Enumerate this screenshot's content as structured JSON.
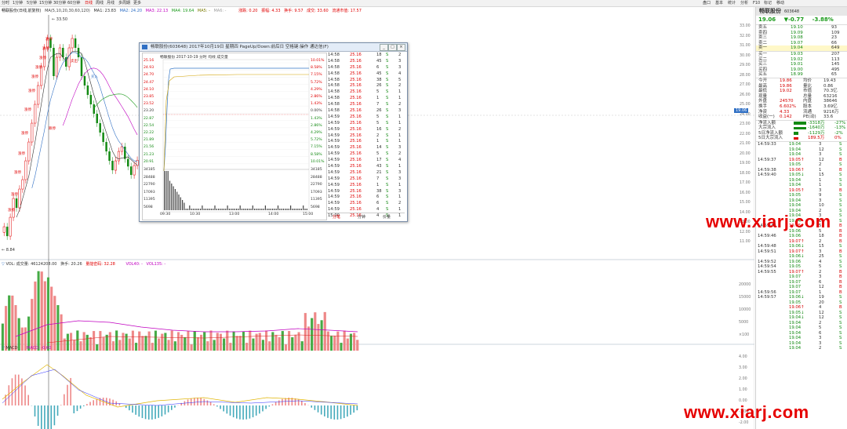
{
  "toolbar": {
    "tabs": [
      "分时",
      "1分钟",
      "5分钟",
      "15分钟",
      "30分钟",
      "60分钟",
      "日线",
      "周线",
      "月线",
      "多周期",
      "更多"
    ],
    "right_tabs": [
      "盘口",
      "基本",
      "统计",
      "分析",
      "F10",
      "标记",
      "移动"
    ]
  },
  "main": {
    "title": "畅联股份(日线,前复权)",
    "ma_label": "MA(5,10,20,30,60,120)",
    "ma_values": [
      "MA1: 23.83",
      "MA2: 24.20",
      "MA3: 22.13",
      "MA4: 19.64",
      "MA5: -",
      "MA6: -"
    ],
    "header_stats": [
      "涨跌: 0.20",
      "振幅: 4.33",
      "换手: 9.57",
      "成交: 33.60",
      "流通市值: 17.57"
    ],
    "high_mark": "33.50",
    "low_mark": "8.84",
    "price_axis": [
      "33.00",
      "32.00",
      "31.00",
      "30.00",
      "29.00",
      "28.00",
      "27.00",
      "26.00",
      "25.00",
      "24.00",
      "23.00",
      "22.00",
      "21.00",
      "20.00",
      "19.00",
      "18.00",
      "17.00",
      "16.00",
      "15.00",
      "14.00",
      "13.00",
      "12.00",
      "11.00"
    ],
    "current_price_tag": "19.06",
    "volume_header": [
      "VOL:",
      "成交量: 46124208.00",
      "换手: 20.26",
      "量能密码: 32.28"
    ],
    "volume_ma": [
      "VOL40: -",
      "VOL135: -"
    ],
    "volume_axis": [
      "20000",
      "15000",
      "10000",
      "5000",
      "×100"
    ],
    "macd_header": [
      "MACD",
      "MACD: -0.60"
    ],
    "macd_axis": [
      "4.00",
      "3.00",
      "2.00",
      "1.00",
      "0.00",
      "-1.00",
      "-2.00"
    ],
    "candles": [
      12,
      11,
      13,
      15,
      14,
      16,
      17,
      19,
      21,
      23,
      25,
      27,
      29,
      31,
      32,
      31,
      28,
      30,
      31,
      30,
      29,
      31,
      32,
      31,
      30,
      28,
      27,
      26,
      25,
      24,
      23,
      22,
      21,
      20,
      19,
      18,
      19,
      20,
      20.5,
      19.2,
      18.4,
      17.5,
      18.5,
      19.06
    ],
    "signal_markers": [
      "涨停",
      "涨停",
      "涨停",
      "涨停",
      "涨停",
      "涨停",
      "涨停",
      "涨停",
      "涨停",
      "涨停",
      "涨停",
      "涨停",
      "跌停",
      "卖出",
      "买入"
    ]
  },
  "popup": {
    "title": "畅联股份(603648)  2017年10月19日 星期四 PageUp/Down:前后日 空格键:操作 通达信(F)",
    "subtitle": "畅联股份  2017-10-19 分时  均线  成交量",
    "price_scale_left": [
      "25.16",
      "24.93",
      "24.70",
      "24.47",
      "24.10",
      "23.85",
      "23.52",
      "23.20",
      "22.87",
      "22.54",
      "22.22",
      "21.89",
      "21.56",
      "21.23",
      "20.91"
    ],
    "price_scale_right": [
      "10.01%",
      "8.58%",
      "7.15%",
      "5.72%",
      "4.29%",
      "2.86%",
      "1.43%",
      "0.00%",
      "1.43%",
      "2.86%",
      "4.29%",
      "5.72%",
      "7.15%",
      "8.58%",
      "10.01%"
    ],
    "vol_scale": [
      "34185",
      "28488",
      "22790",
      "17093",
      "11395",
      "5698"
    ],
    "time_axis": [
      "09:30",
      "10:30",
      "13:00",
      "14:00",
      "15:00"
    ],
    "trades": [
      [
        "14:58",
        "25.16",
        "18",
        "S",
        "2"
      ],
      [
        "14:58",
        "25.16",
        "45",
        "S",
        "3"
      ],
      [
        "14:58",
        "25.16",
        "6",
        "S",
        "3"
      ],
      [
        "14:58",
        "25.16",
        "45",
        "S",
        "4"
      ],
      [
        "14:58",
        "25.16",
        "38",
        "S",
        "5"
      ],
      [
        "14:58",
        "25.16",
        "26",
        "S",
        "2"
      ],
      [
        "14:58",
        "25.16",
        "5",
        "S",
        "1"
      ],
      [
        "14:58",
        "25.16",
        "1",
        "S",
        "1"
      ],
      [
        "14:58",
        "25.16",
        "7",
        "S",
        "2"
      ],
      [
        "14:58",
        "25.16",
        "26",
        "S",
        "3"
      ],
      [
        "14:59",
        "25.16",
        "5",
        "S",
        "1"
      ],
      [
        "14:59",
        "25.16",
        "5",
        "S",
        "1"
      ],
      [
        "14:59",
        "25.16",
        "16",
        "S",
        "2"
      ],
      [
        "14:59",
        "25.16",
        "2",
        "S",
        "1"
      ],
      [
        "14:59",
        "25.16",
        "1",
        "S",
        "1"
      ],
      [
        "14:59",
        "25.16",
        "14",
        "S",
        "3"
      ],
      [
        "14:59",
        "25.16",
        "5",
        "S",
        "2"
      ],
      [
        "14:59",
        "25.16",
        "17",
        "S",
        "4"
      ],
      [
        "14:59",
        "25.16",
        "43",
        "S",
        "1"
      ],
      [
        "14:59",
        "25.16",
        "21",
        "S",
        "3"
      ],
      [
        "14:59",
        "25.16",
        "7",
        "S",
        "3"
      ],
      [
        "14:59",
        "25.16",
        "1",
        "S",
        "1"
      ],
      [
        "14:59",
        "25.16",
        "38",
        "S",
        "3"
      ],
      [
        "14:59",
        "25.16",
        "6",
        "S",
        "1"
      ],
      [
        "14:59",
        "25.16",
        "6",
        "S",
        "2"
      ],
      [
        "14:59",
        "25.16",
        "4",
        "S",
        "1"
      ],
      [
        "15:00",
        "25.16",
        "4",
        "S",
        "1"
      ]
    ],
    "footer_tabs": [
      "分笔",
      "分钟",
      "价量"
    ]
  },
  "right": {
    "name": "畅联股份",
    "code": "603648",
    "price": "19.06",
    "change": "▼-0.77",
    "pct": "-3.88%",
    "asks": [
      [
        "卖五",
        "19.10",
        "93"
      ],
      [
        "卖四",
        "19.09",
        "109"
      ],
      [
        "卖三",
        "19.08",
        "23"
      ],
      [
        "卖二",
        "19.07",
        "66"
      ],
      [
        "卖一",
        "19.04",
        "649"
      ]
    ],
    "bids": [
      [
        "买一",
        "19.03",
        "207"
      ],
      [
        "买二",
        "19.02",
        "113"
      ],
      [
        "买三",
        "19.01",
        "145"
      ],
      [
        "买四",
        "19.00",
        "495"
      ],
      [
        "买五",
        "18.99",
        "65"
      ]
    ],
    "stats": [
      [
        "今开",
        "19.86",
        "均价",
        "19.43"
      ],
      [
        "最高",
        "19.86",
        "量比",
        "0.86"
      ],
      [
        "最低",
        "19.02",
        "市值",
        "70.3亿"
      ],
      [
        "现量",
        "",
        "总量",
        "63216"
      ],
      [
        "外盘",
        "24570",
        "内盘",
        "38646"
      ],
      [
        "换手",
        "6.602%",
        "股本",
        "3.69亿"
      ],
      [
        "净资",
        "4.33",
        "流通",
        "9216万"
      ],
      [
        "收益(一)",
        "0.142",
        "PE(动)",
        "33.6"
      ]
    ],
    "flows": [
      [
        "净流入额",
        "-3318万",
        "-27%"
      ],
      [
        "大宗流入",
        "-1640万",
        "-13%"
      ],
      [
        "5日净流入额",
        "-1129万",
        "-2%"
      ],
      [
        "5日大宗流入",
        "189.5万",
        "0%"
      ]
    ],
    "ticks": [
      [
        "14:59:33",
        "19.04",
        "3",
        "S"
      ],
      [
        "",
        "19.04",
        "12",
        "S"
      ],
      [
        "",
        "19.04",
        "3",
        "S"
      ],
      [
        "14:59:37",
        "19.05↑",
        "12",
        "B"
      ],
      [
        "",
        "19.05",
        "2",
        "S"
      ],
      [
        "14:59:38",
        "19.06↑",
        "1",
        "B"
      ],
      [
        "14:59:40",
        "19.05↓",
        "15",
        "S"
      ],
      [
        "",
        "19.04",
        "1",
        "S"
      ],
      [
        "",
        "19.04",
        "1",
        "S"
      ],
      [
        "",
        "19.05↑",
        "3",
        "B"
      ],
      [
        "",
        "19.05",
        "9",
        "S"
      ],
      [
        "",
        "19.04",
        "3",
        "S"
      ],
      [
        "",
        "19.04",
        "10",
        "S"
      ],
      [
        "",
        "19.04",
        "2",
        "S"
      ],
      [
        "",
        "19.04",
        "3",
        "S"
      ],
      [
        "",
        "19.04",
        "18",
        "S"
      ],
      [
        "14:59:44",
        "19.05↑",
        "5",
        "B"
      ],
      [
        "",
        "19.06",
        "5",
        "B"
      ],
      [
        "14:59:46",
        "19.06",
        "18",
        "B"
      ],
      [
        "",
        "19.07↑",
        "2",
        "B"
      ],
      [
        "14:59:48",
        "19.06↓",
        "15",
        "S"
      ],
      [
        "14:59:51",
        "19.07↑",
        "3",
        "B"
      ],
      [
        "",
        "19.06↓",
        "25",
        "S"
      ],
      [
        "14:59:52",
        "19.06",
        "4",
        "S"
      ],
      [
        "14:59:54",
        "19.05",
        "5",
        "S"
      ],
      [
        "14:59:55",
        "19.07↑",
        "2",
        "B"
      ],
      [
        "",
        "19.07",
        "3",
        "B"
      ],
      [
        "",
        "19.07",
        "6",
        "B"
      ],
      [
        "",
        "19.07",
        "12",
        "B"
      ],
      [
        "14:59:56",
        "19.07",
        "1",
        "B"
      ],
      [
        "14:59:57",
        "19.06↓",
        "19",
        "S"
      ],
      [
        "",
        "19.05",
        "20",
        "S"
      ],
      [
        "",
        "19.06↑",
        "4",
        "B"
      ],
      [
        "",
        "19.05↓",
        "12",
        "S"
      ],
      [
        "",
        "19.04↓",
        "12",
        "S"
      ],
      [
        "",
        "19.04",
        "2",
        "S"
      ],
      [
        "",
        "19.04",
        "5",
        "S"
      ],
      [
        "",
        "19.04",
        "6",
        "S"
      ],
      [
        "",
        "19.04",
        "3",
        "S"
      ],
      [
        "",
        "19.04",
        "3",
        "S"
      ],
      [
        "",
        "19.04",
        "2",
        "S"
      ]
    ]
  },
  "watermark": "www.xiarj.com",
  "colors": {
    "up": "#e00000",
    "down": "#138a13",
    "ma_blue": "#2f6fc4",
    "bg": "#ffffff"
  }
}
